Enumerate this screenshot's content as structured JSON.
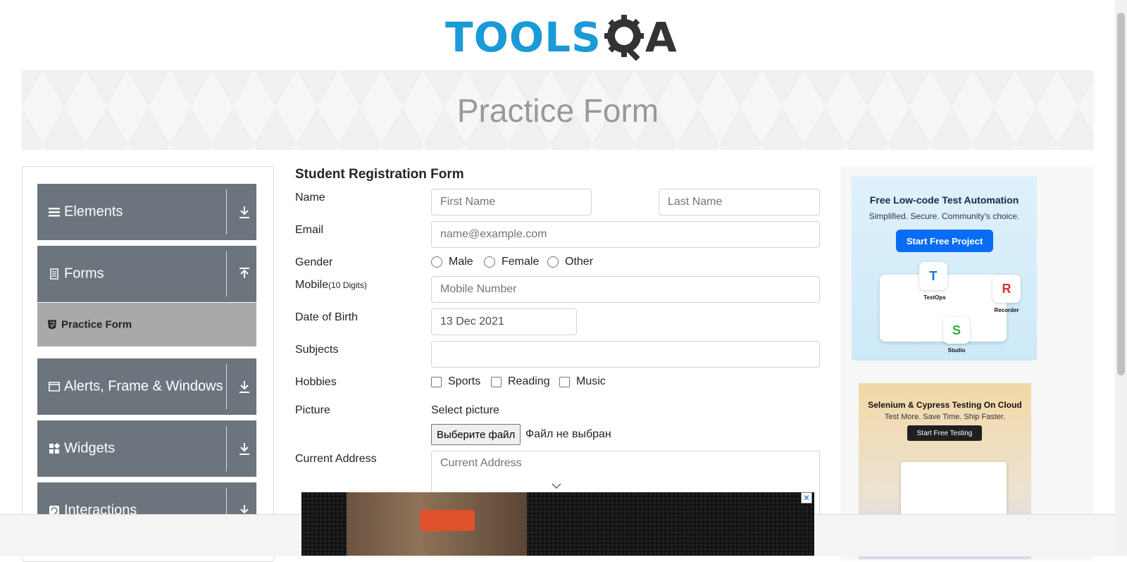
{
  "header": {
    "logo_tools": "TOOLS",
    "logo_qa_a": "A"
  },
  "banner": {
    "title": "Practice Form"
  },
  "sidebar": {
    "groups": [
      {
        "label": "Elements",
        "icon": "menu-icon",
        "arrow": "download-arrow-icon"
      },
      {
        "label": "Forms",
        "icon": "document-icon",
        "arrow": "upload-arrow-icon"
      },
      {
        "label": "Alerts, Frame & Windows",
        "icon": "window-icon",
        "arrow": "download-arrow-icon"
      },
      {
        "label": "Widgets",
        "icon": "widgets-icon",
        "arrow": "download-arrow-icon"
      },
      {
        "label": "Interactions",
        "icon": "interactions-icon",
        "arrow": "download-arrow-icon"
      }
    ],
    "active_item": "Practice Form"
  },
  "form": {
    "title": "Student Registration Form",
    "name_label": "Name",
    "first_name_placeholder": "First Name",
    "last_name_placeholder": "Last Name",
    "email_label": "Email",
    "email_placeholder": "name@example.com",
    "gender_label": "Gender",
    "gender_options": [
      "Male",
      "Female",
      "Other"
    ],
    "mobile_label": "Mobile",
    "mobile_hint": "(10 Digits)",
    "mobile_placeholder": "Mobile Number",
    "dob_label": "Date of Birth",
    "dob_value": "13 Dec 2021",
    "subjects_label": "Subjects",
    "hobbies_label": "Hobbies",
    "hobbies_options": [
      "Sports",
      "Reading",
      "Music"
    ],
    "picture_label": "Picture",
    "picture_caption": "Select picture",
    "file_button": "Выберите файл",
    "file_status": "Файл не выбран",
    "address_label": "Current Address",
    "address_placeholder": "Current Address"
  },
  "ads": {
    "ad1": {
      "title": "Free Low-code Test Automation",
      "subtitle": "Simplified. Secure. Community's choice.",
      "button": "Start Free Project",
      "labels": [
        "TestOps",
        "Recorder",
        "Studio"
      ]
    },
    "ad2": {
      "title": "Selenium & Cypress Testing On Cloud",
      "subtitle": "Test More. Save Time. Ship Faster.",
      "button": "Start Free Testing"
    }
  },
  "colors": {
    "accent": "#1a9ad6",
    "sidebar_group": "#6c757d",
    "active_item": "#a9a9a9"
  }
}
